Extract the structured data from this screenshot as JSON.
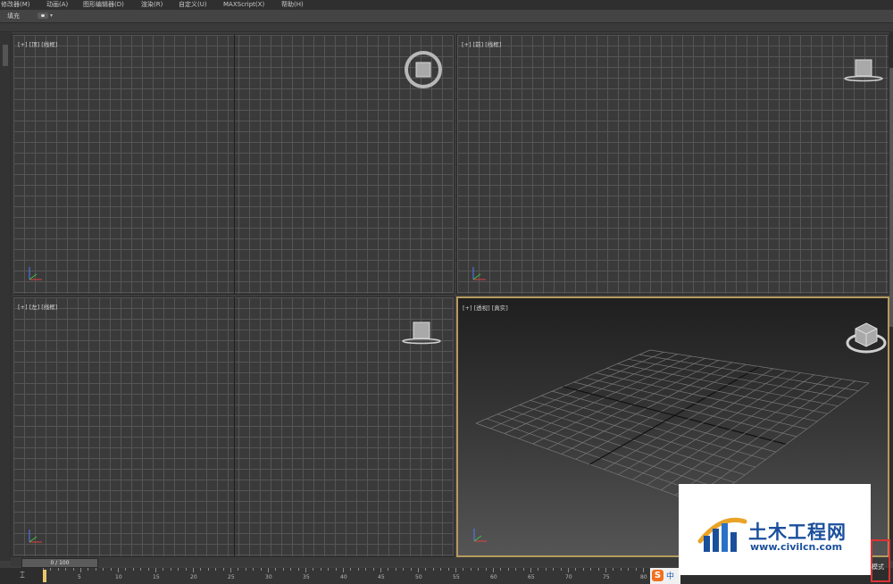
{
  "menu": {
    "items": [
      "修改器(M)",
      "动画(A)",
      "图形编辑器(D)",
      "渲染(R)",
      "自定义(U)",
      "MAXScript(X)",
      "帮助(H)"
    ]
  },
  "toolbar": {
    "fill_label": "填充"
  },
  "viewports": {
    "top": "[+] [顶] [线框]",
    "front": "[+] [前] [线框]",
    "left": "[+] [左] [线框]",
    "perspective": "[+] [透视] [真实]"
  },
  "timeline": {
    "slider": "0 / 100",
    "ticks": [
      "5",
      "10",
      "15",
      "20",
      "25",
      "30",
      "35",
      "40",
      "45",
      "50",
      "55",
      "60",
      "65",
      "70",
      "75",
      "80"
    ]
  },
  "taskbar": {
    "ime_logo": "S",
    "ime_lang": "中"
  },
  "status": {
    "mode": "模式"
  },
  "watermark": {
    "title": "土木工程网",
    "url": "www.civilcn.com"
  },
  "colors": {
    "accent_border": "#b59b5e",
    "highlight_box": "#dd3333",
    "brand_blue": "#1a4f9c"
  }
}
